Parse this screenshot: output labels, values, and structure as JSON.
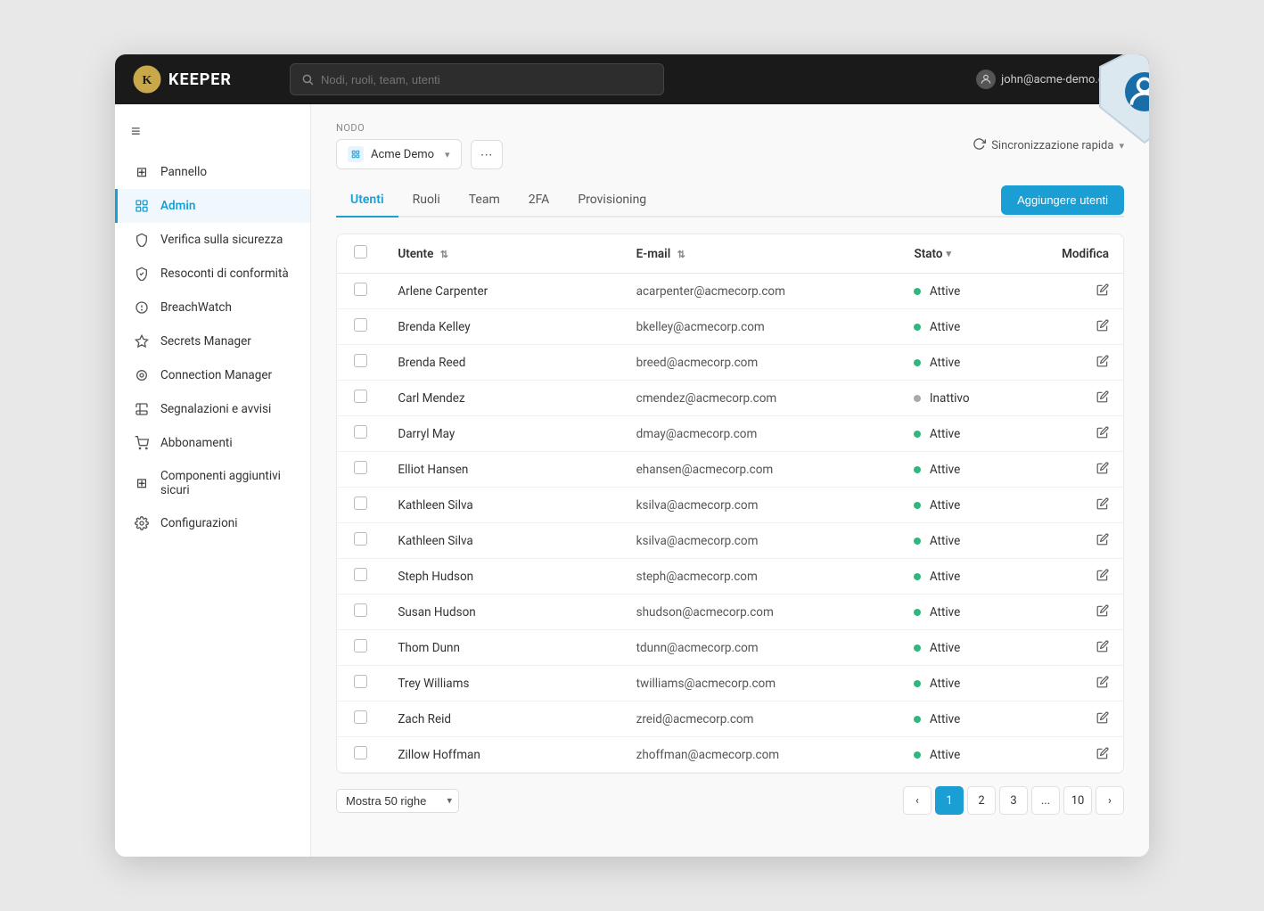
{
  "app": {
    "title": "KEEPER",
    "search_placeholder": "Nodi, ruoli, team, utenti",
    "user_email": "john@acme-demo.com"
  },
  "sidebar": {
    "hamburger": "≡",
    "items": [
      {
        "id": "pannello",
        "label": "Pannello",
        "icon": "⊞",
        "active": false
      },
      {
        "id": "admin",
        "label": "Admin",
        "icon": "🛡",
        "active": true
      },
      {
        "id": "verifica",
        "label": "Verifica sulla sicurezza",
        "icon": "🛡",
        "active": false
      },
      {
        "id": "resoconti",
        "label": "Resoconti di conformità",
        "icon": "🛡",
        "active": false
      },
      {
        "id": "breachwatch",
        "label": "BreachWatch",
        "icon": "🛡",
        "active": false
      },
      {
        "id": "secrets",
        "label": "Secrets Manager",
        "icon": "⚙",
        "active": false
      },
      {
        "id": "connection",
        "label": "Connection Manager",
        "icon": "◎",
        "active": false
      },
      {
        "id": "segnalazioni",
        "label": "Segnalazioni e avvisi",
        "icon": "📋",
        "active": false
      },
      {
        "id": "abbonamenti",
        "label": "Abbonamenti",
        "icon": "🛒",
        "active": false
      },
      {
        "id": "componenti",
        "label": "Componenti aggiuntivi sicuri",
        "icon": "⊞",
        "active": false
      },
      {
        "id": "configurazioni",
        "label": "Configurazioni",
        "icon": "⚙",
        "active": false
      }
    ]
  },
  "node": {
    "label": "Nodo",
    "selected": "Acme Demo",
    "sync_label": "Sincronizzazione rapida"
  },
  "tabs": [
    {
      "id": "utenti",
      "label": "Utenti",
      "active": true
    },
    {
      "id": "ruoli",
      "label": "Ruoli",
      "active": false
    },
    {
      "id": "team",
      "label": "Team",
      "active": false
    },
    {
      "id": "2fa",
      "label": "2FA",
      "active": false
    },
    {
      "id": "provisioning",
      "label": "Provisioning",
      "active": false
    }
  ],
  "add_user_btn": "Aggiungere utenti",
  "table": {
    "headers": {
      "user": "Utente",
      "email": "E-mail",
      "status": "Stato",
      "edit": "Modifica"
    },
    "rows": [
      {
        "name": "Arlene Carpenter",
        "email": "acarpenter@acmecorp.com",
        "status": "Attive",
        "active": true
      },
      {
        "name": "Brenda Kelley",
        "email": "bkelley@acmecorp.com",
        "status": "Attive",
        "active": true
      },
      {
        "name": "Brenda Reed",
        "email": "breed@acmecorp.com",
        "status": "Attive",
        "active": true
      },
      {
        "name": "Carl Mendez",
        "email": "cmendez@acmecorp.com",
        "status": "Inattivo",
        "active": false
      },
      {
        "name": "Darryl May",
        "email": "dmay@acmecorp.com",
        "status": "Attive",
        "active": true
      },
      {
        "name": "Elliot Hansen",
        "email": "ehansen@acmecorp.com",
        "status": "Attive",
        "active": true
      },
      {
        "name": "Kathleen Silva",
        "email": "ksilva@acmecorp.com",
        "status": "Attive",
        "active": true
      },
      {
        "name": "Kathleen Silva",
        "email": "ksilva@acmecorp.com",
        "status": "Attive",
        "active": true
      },
      {
        "name": "Steph Hudson",
        "email": "steph@acmecorp.com",
        "status": "Attive",
        "active": true
      },
      {
        "name": "Susan Hudson",
        "email": "shudson@acmecorp.com",
        "status": "Attive",
        "active": true
      },
      {
        "name": "Thom Dunn",
        "email": "tdunn@acmecorp.com",
        "status": "Attive",
        "active": true
      },
      {
        "name": "Trey Williams",
        "email": "twilliams@acmecorp.com",
        "status": "Attive",
        "active": true
      },
      {
        "name": "Zach Reid",
        "email": "zreid@acmecorp.com",
        "status": "Attive",
        "active": true
      },
      {
        "name": "Zillow Hoffman",
        "email": "zhoffman@acmecorp.com",
        "status": "Attive",
        "active": true
      }
    ]
  },
  "pagination": {
    "rows_label": "Mostra 50 righe",
    "pages": [
      "1",
      "2",
      "3",
      "...",
      "10"
    ],
    "current_page": "1"
  }
}
